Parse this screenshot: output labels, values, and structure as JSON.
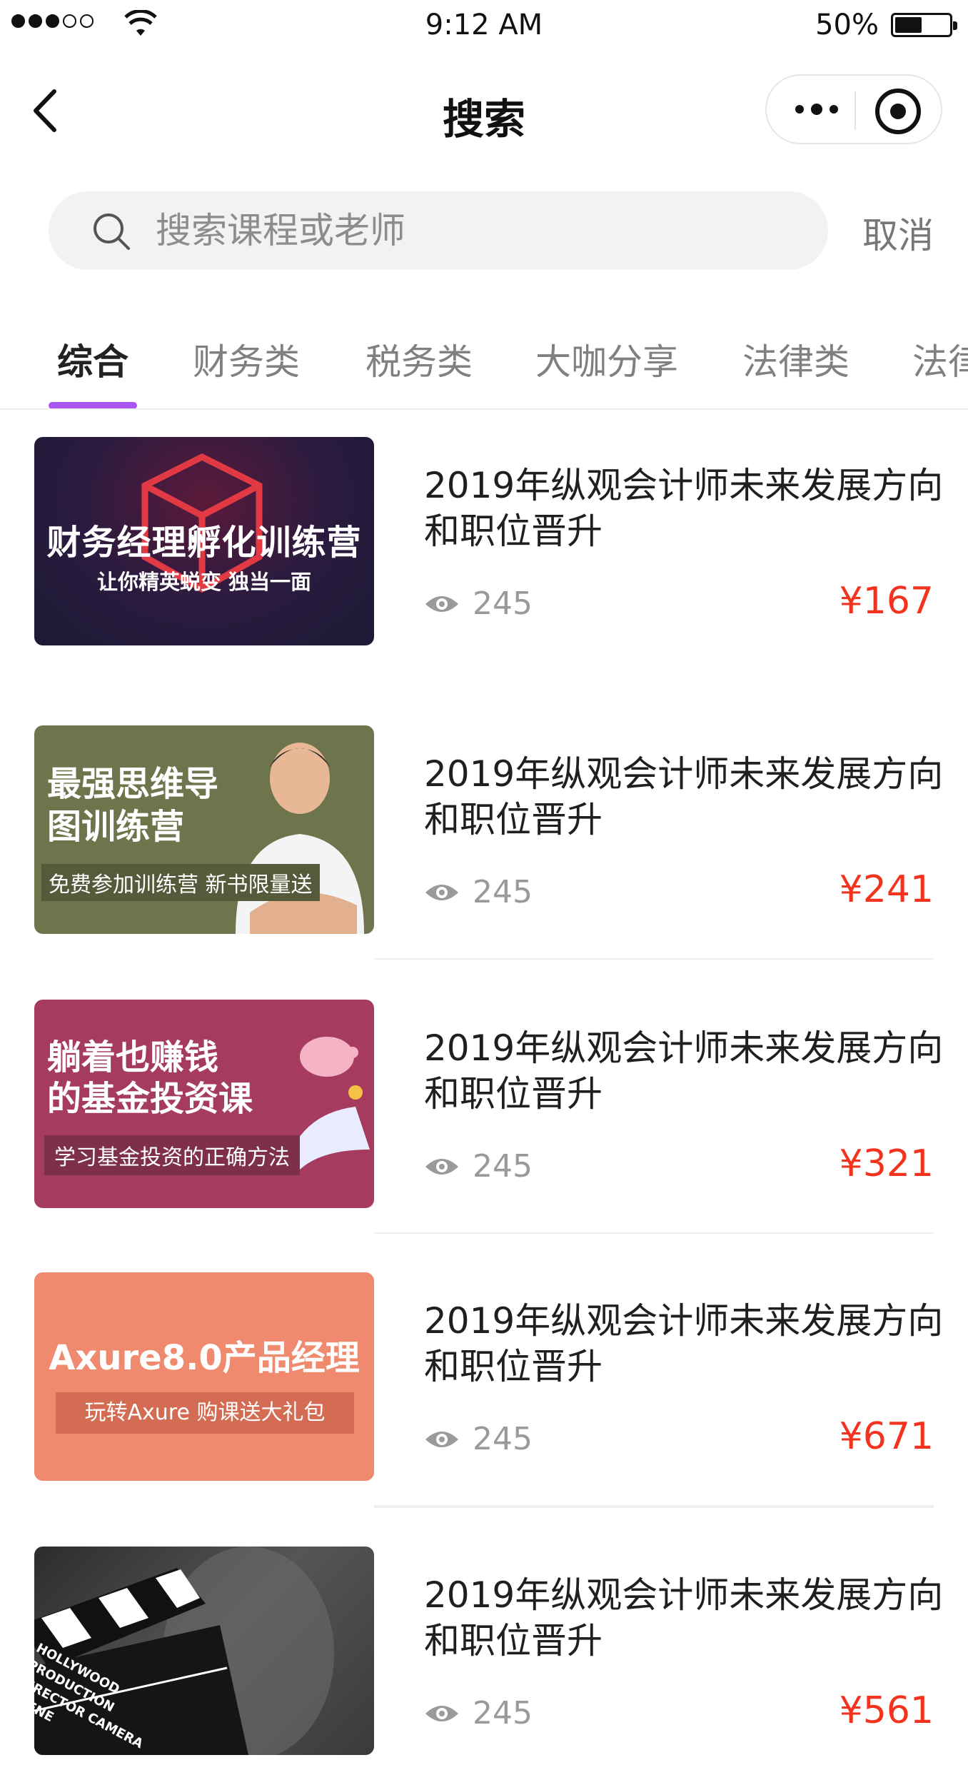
{
  "status_bar": {
    "time": "9:12 AM",
    "battery_percent": "50%",
    "battery_level": 0.5,
    "signal_bars_filled": 3,
    "signal_bars_total": 5
  },
  "nav": {
    "title": "搜索",
    "icons": [
      "back-icon",
      "more-icon",
      "target-icon"
    ]
  },
  "search": {
    "placeholder": "搜索课程或老师",
    "value": "",
    "cancel_label": "取消"
  },
  "tabs": [
    {
      "label": "综合",
      "active": true
    },
    {
      "label": "财务类",
      "active": false
    },
    {
      "label": "税务类",
      "active": false
    },
    {
      "label": "大咖分享",
      "active": false
    },
    {
      "label": "法律类",
      "active": false
    },
    {
      "label": "法律",
      "active": false
    }
  ],
  "colors": {
    "accent": "#a955f3",
    "price": "#f4331f"
  },
  "courses": [
    {
      "thumb": {
        "title": "财务经理孵化训练营",
        "subtitle": "让你精英蜕变 独当一面"
      },
      "title": "2019年纵观会计师未来发展方向和职位晋升",
      "views": "245",
      "price": "¥167"
    },
    {
      "thumb": {
        "title_line1": "最强思维导",
        "title_line2": "图训练营",
        "subtitle": "免费参加训练营 新书限量送"
      },
      "title": "2019年纵观会计师未来发展方向和职位晋升",
      "views": "245",
      "price": "¥241"
    },
    {
      "thumb": {
        "title_line1": "躺着也赚钱",
        "title_line2": "的基金投资课",
        "subtitle": "学习基金投资的正确方法"
      },
      "title": "2019年纵观会计师未来发展方向和职位晋升",
      "views": "245",
      "price": "¥321"
    },
    {
      "thumb": {
        "title": "Axure8.0产品经理",
        "subtitle": "玩转Axure 购课送大礼包"
      },
      "title": "2019年纵观会计师未来发展方向和职位晋升",
      "views": "245",
      "price": "¥671"
    },
    {
      "thumb": {
        "clapper_text": "HOLLYWOOD PRODUCTION DIRECTOR CAMERA SCENE"
      },
      "title": "2019年纵观会计师未来发展方向和职位晋升",
      "views": "245",
      "price": "¥561"
    }
  ]
}
